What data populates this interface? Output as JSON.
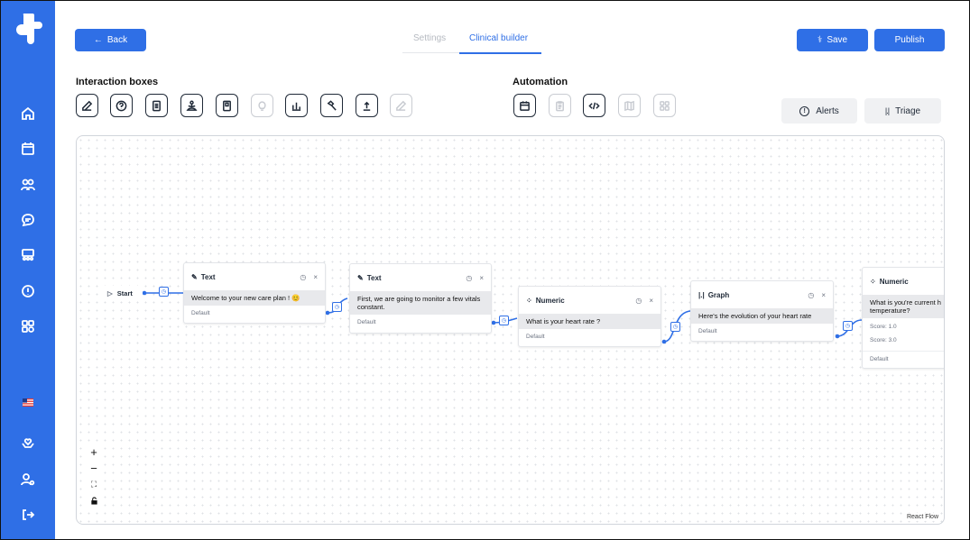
{
  "header": {
    "back_label": "Back",
    "tabs": [
      {
        "label": "Settings",
        "active": false
      },
      {
        "label": "Clinical builder",
        "active": true
      }
    ],
    "save_label": "Save",
    "publish_label": "Publish"
  },
  "interaction": {
    "title": "Interaction boxes",
    "tools": [
      {
        "icon": "edit-icon",
        "enabled": true
      },
      {
        "icon": "question-icon",
        "enabled": true
      },
      {
        "icon": "document-icon",
        "enabled": true
      },
      {
        "icon": "meditation-icon",
        "enabled": true
      },
      {
        "icon": "booklet-icon",
        "enabled": true
      },
      {
        "icon": "lightbulb-icon",
        "enabled": false
      },
      {
        "icon": "bar-chart-icon",
        "enabled": true
      },
      {
        "icon": "hammer-icon",
        "enabled": true
      },
      {
        "icon": "upload-icon",
        "enabled": true
      },
      {
        "icon": "edit-icon",
        "enabled": false
      }
    ]
  },
  "automation": {
    "title": "Automation",
    "tools": [
      {
        "icon": "calendar-icon",
        "enabled": true
      },
      {
        "icon": "clipboard-icon",
        "enabled": false
      },
      {
        "icon": "code-icon",
        "enabled": true
      },
      {
        "icon": "map-icon",
        "enabled": false
      },
      {
        "icon": "grid-icon",
        "enabled": false
      }
    ],
    "alerts_label": "Alerts",
    "triage_label": "Triage"
  },
  "flow": {
    "start_label": "Start",
    "nodes": [
      {
        "type": "Text",
        "text": "Welcome to your new care plan ! 😊",
        "footer": "Default"
      },
      {
        "type": "Text",
        "text": "First, we are going to monitor a few vitals constant.",
        "footer": "Default"
      },
      {
        "type": "Numeric",
        "text": "What is your heart rate ?",
        "footer": "Default"
      },
      {
        "type": "Graph",
        "text": "Here's the evolution of your heart rate",
        "footer": "Default"
      },
      {
        "type": "Numeric",
        "text": "What is you're current h temperature?",
        "score1": "Score: 1.0",
        "score2": "Score: 3.0",
        "footer": "Default"
      }
    ],
    "zoom_in": "+",
    "zoom_out": "−",
    "attribution": "React Flow"
  },
  "colors": {
    "brand": "#2f6fe6",
    "sidebar": "#2f6fe6",
    "node_body": "#e8e9ec"
  }
}
